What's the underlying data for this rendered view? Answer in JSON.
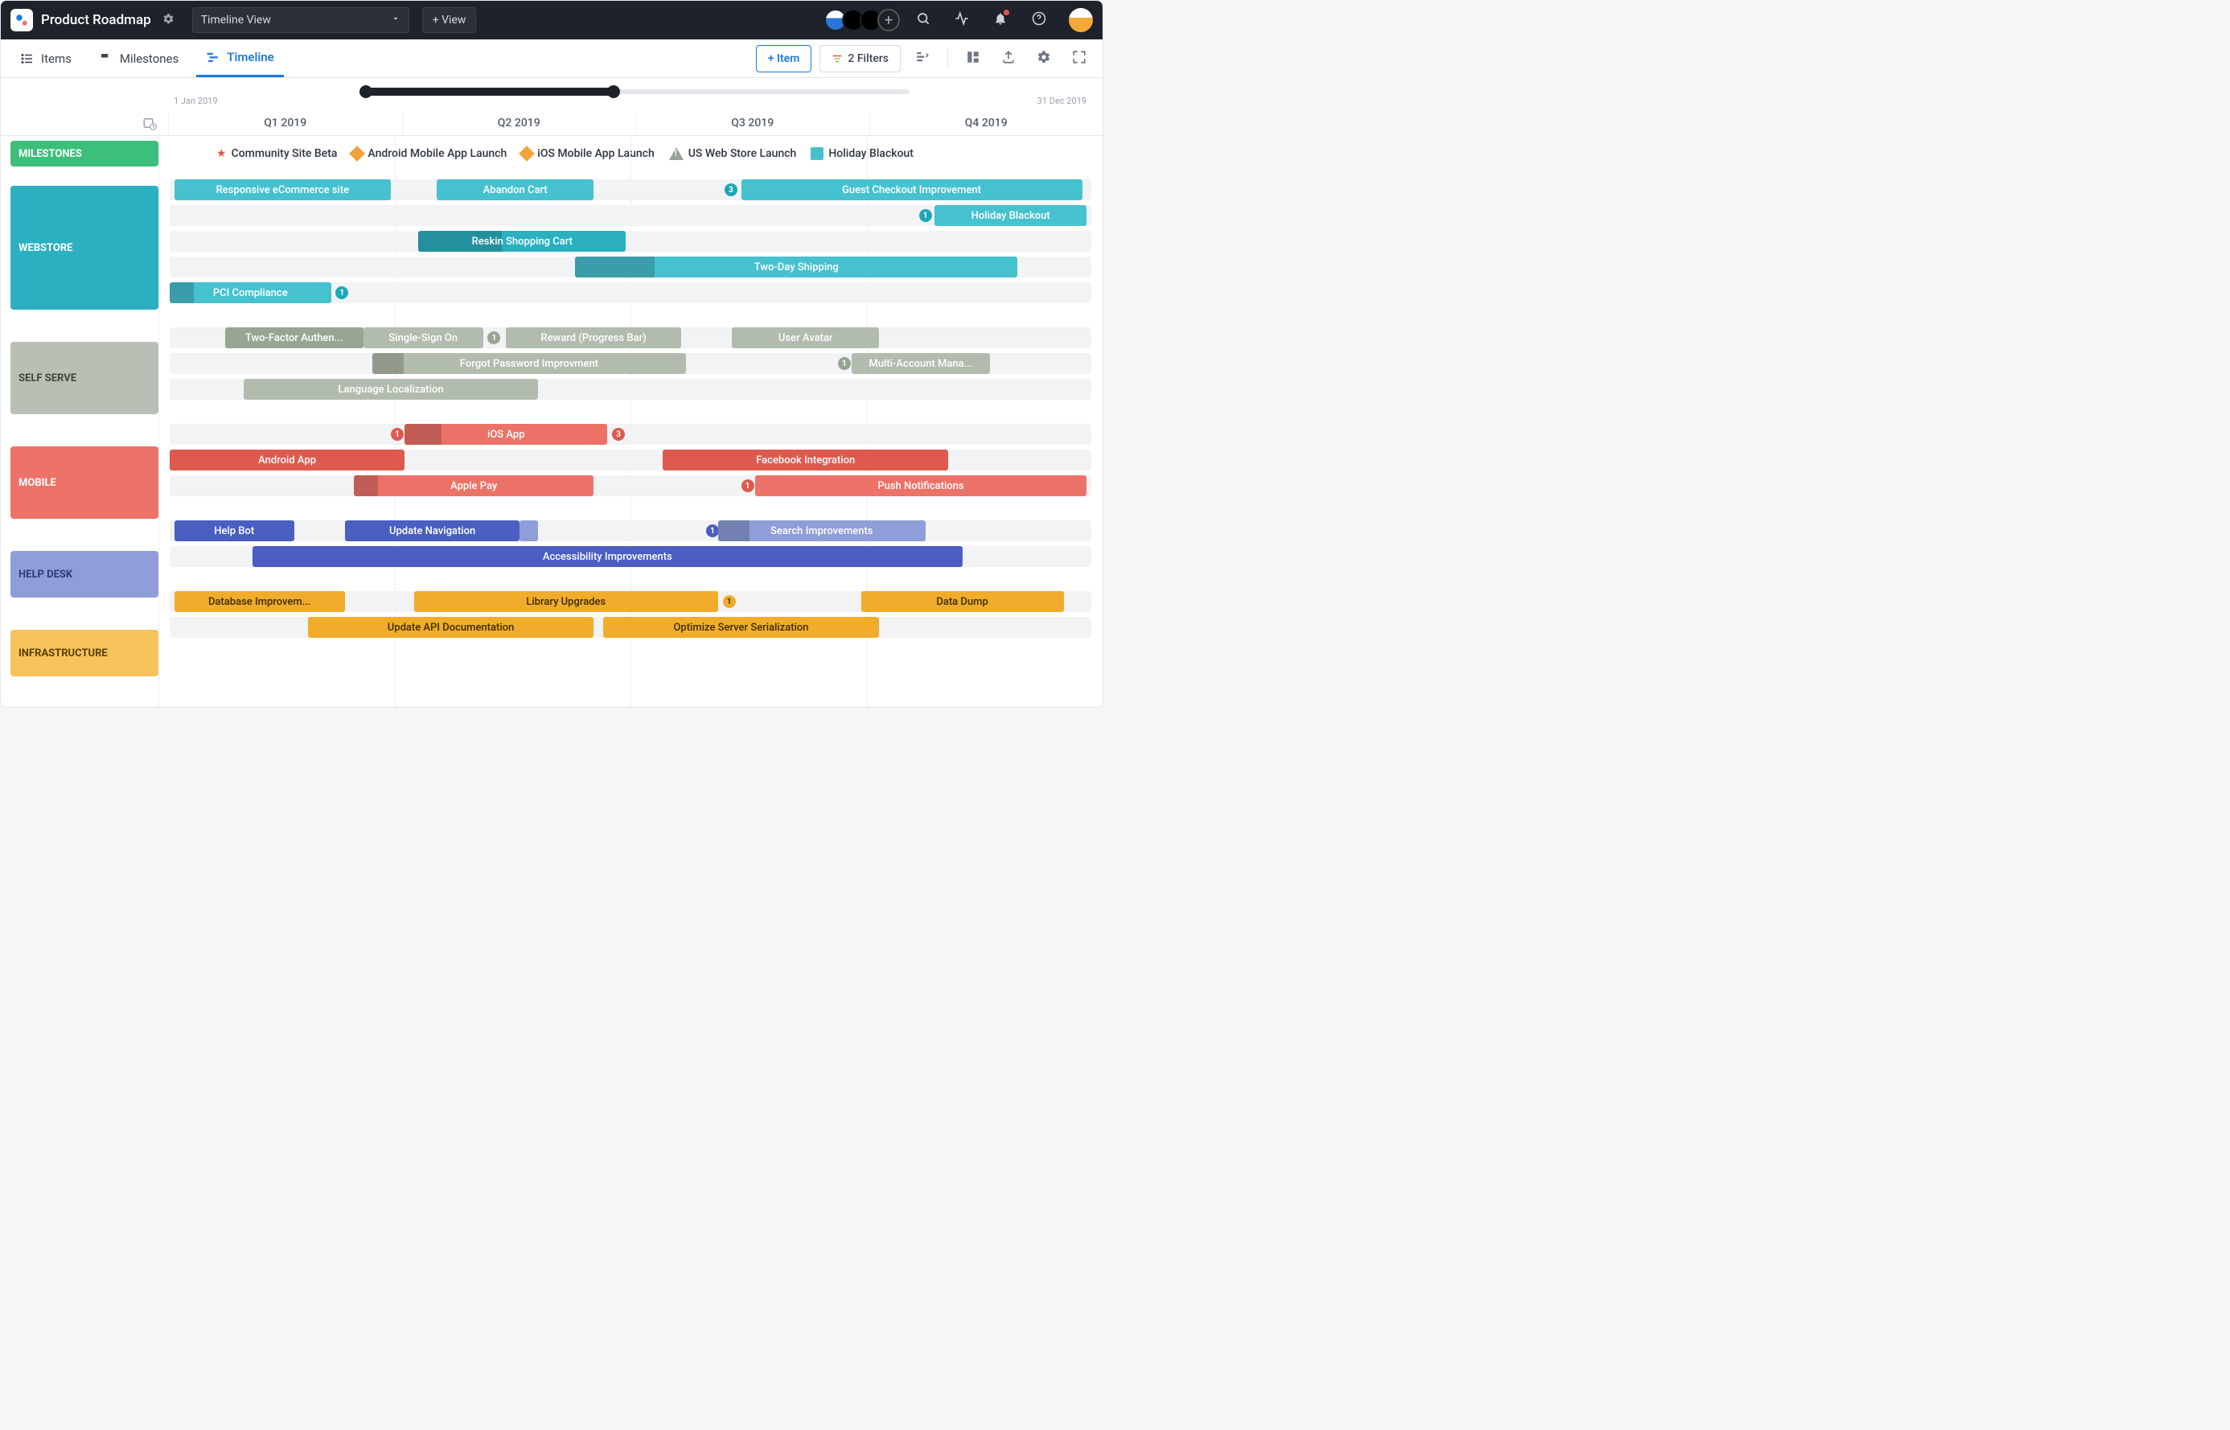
{
  "header": {
    "title": "Product Roadmap",
    "viewDropdown": "Timeline View",
    "addView": "+ View"
  },
  "nav": {
    "items": "Items",
    "milestones": "Milestones",
    "timeline": "Timeline",
    "addItem": "+ Item",
    "filters": "2 Filters"
  },
  "ruler": {
    "start": "1 Jan 2019",
    "end": "31 Dec 2019",
    "q1": "Q1 2019",
    "q2": "Q2 2019",
    "q3": "Q3 2019",
    "q4": "Q4 2019"
  },
  "swimlanes": {
    "milestones": "MILESTONES",
    "webstore": "WEBSTORE",
    "selfserve": "SELF SERVE",
    "mobile": "MOBILE",
    "helpdesk": "HELP DESK",
    "infra": "INFRASTRUCTURE"
  },
  "milestones": {
    "m1": "Community Site Beta",
    "m2": "Android Mobile App Launch",
    "m3": "iOS Mobile App Launch",
    "m4": "US Web Store Launch",
    "m5": "Holiday Blackout"
  },
  "bars": {
    "w1": "Responsive eCommerce site",
    "w2": "Abandon Cart",
    "w3": "Guest Checkout Improvement",
    "w3b": "3",
    "w4": "Holiday Blackout",
    "w4b": "1",
    "w5": "Reskin Shopping Cart",
    "w6": "Two-Day Shipping",
    "w7": "PCI Compliance",
    "w7b": "1",
    "s1": "Two-Factor Authen...",
    "s2": "Single-Sign On",
    "s2b": "1",
    "s3": "Reward (Progress Bar)",
    "s4": "User Avatar",
    "s5": "Forgot Password Improvment",
    "s6": "Multi-Account Mana...",
    "s6b": "1",
    "s7": "Language Localization",
    "m1": "iOS App",
    "m1b": "1",
    "m1c": "3",
    "m2": "Android App",
    "m3": "Facebook Integration",
    "m4": "Apple Pay",
    "m5": "Push Notifications",
    "m5b": "1",
    "h1": "Help Bot",
    "h2": "Update Navigation",
    "h3": "Search Improvements",
    "h3b": "1",
    "h4": "Accessibility Improvements",
    "i1": "Database Improvem...",
    "i2": "Library Upgrades",
    "i2b": "1",
    "i3": "Data Dump",
    "i4": "Update API Documentation",
    "i5": "Optimize Server Serialization"
  }
}
